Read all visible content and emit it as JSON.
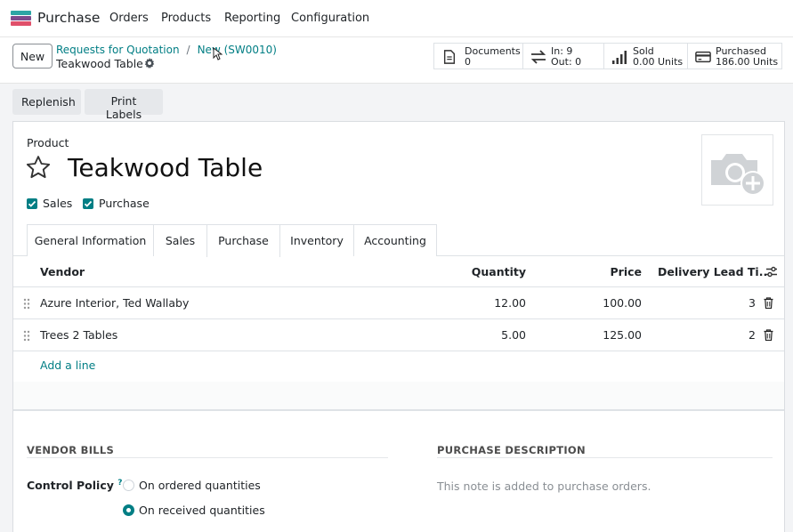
{
  "nav": {
    "app_name": "Purchase",
    "menu": [
      "Orders",
      "Products",
      "Reporting",
      "Configuration"
    ],
    "logo_colors": [
      "#2ca5a5",
      "#7c4a8c",
      "#e0506a"
    ]
  },
  "control": {
    "new_label": "New",
    "breadcrumb": [
      "Requests for Quotation",
      "New (SW0010)"
    ],
    "breadcrumb_sep": "/",
    "record_name": "Teakwood Table"
  },
  "smart_buttons": {
    "documents": {
      "label": "Documents",
      "value": "0",
      "icon": "document-icon"
    },
    "moves": {
      "in": "In: 9",
      "out": "Out: 0",
      "icon": "transfer-arrows-icon"
    },
    "sold": {
      "label": "Sold",
      "value": "0.00 Units",
      "icon": "bar-chart-icon"
    },
    "purchased": {
      "label": "Purchased",
      "value": "186.00 Units",
      "icon": "credit-card-icon"
    }
  },
  "actions": [
    "Replenish",
    "Print Labels"
  ],
  "product": {
    "type_label": "Product",
    "name": "Teakwood Table",
    "checkboxes": [
      {
        "label": "Sales",
        "checked": true
      },
      {
        "label": "Purchase",
        "checked": true
      }
    ]
  },
  "tabs": [
    "General Information",
    "Sales",
    "Purchase",
    "Inventory",
    "Accounting"
  ],
  "active_tab": "Purchase",
  "vendor_table": {
    "columns": [
      "Vendor",
      "Quantity",
      "Price",
      "Delivery Lead Ti..."
    ],
    "rows": [
      {
        "vendor": "Azure Interior, Ted Wallaby",
        "quantity": "12.00",
        "price": "100.00",
        "lead": "3"
      },
      {
        "vendor": "Trees 2 Tables",
        "quantity": "5.00",
        "price": "125.00",
        "lead": "2"
      }
    ],
    "add_line": "Add a line"
  },
  "vendor_bills": {
    "title": "VENDOR BILLS",
    "control_policy_label": "Control Policy",
    "help_mark": "?",
    "options": [
      {
        "label": "On ordered quantities",
        "selected": false
      },
      {
        "label": "On received quantities",
        "selected": true
      }
    ]
  },
  "purchase_description": {
    "title": "PURCHASE DESCRIPTION",
    "placeholder": "This note is added to purchase orders."
  },
  "colors": {
    "accent": "#017e84",
    "link": "#017e84"
  }
}
